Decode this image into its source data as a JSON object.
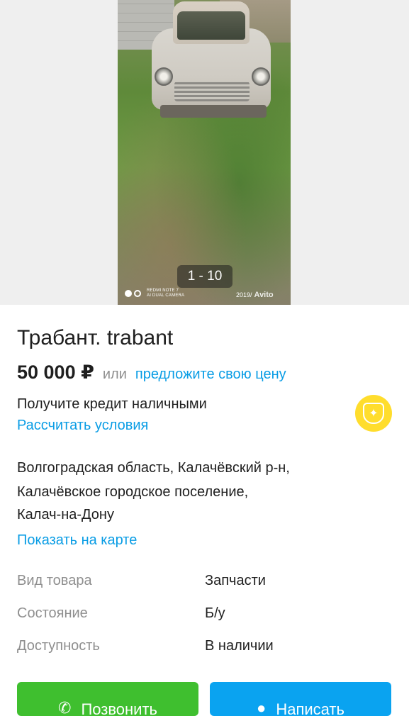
{
  "gallery": {
    "counter": "1 - 10",
    "watermark_left": "REDMI NOTE 7\nAI DUAL CAMERA",
    "watermark_date": "2019/",
    "watermark_brand": "Avito"
  },
  "listing": {
    "title": "Трабант. trabant",
    "price": "50 000 ₽",
    "or_text": "или",
    "offer_link": "предложите свою цену"
  },
  "credit": {
    "title": "Получите кредит наличными",
    "link": "Рассчитать условия"
  },
  "location": {
    "lines": [
      "Волгоградская область, Калачёвский р-н,",
      "Калачёвское городское поселение,",
      "Калач-на-Дону"
    ],
    "map_link": "Показать на карте"
  },
  "params": [
    {
      "label": "Вид товара",
      "value": "Запчасти"
    },
    {
      "label": "Состояние",
      "value": "Б/у"
    },
    {
      "label": "Доступность",
      "value": "В наличии"
    }
  ],
  "actions": {
    "call_label": "Позвонить",
    "write_label": "Написать"
  },
  "colors": {
    "link": "#0a9de5",
    "call_button": "#3fbf2f",
    "write_button": "#0aa3f0",
    "bank_logo": "#ffdd2d"
  }
}
